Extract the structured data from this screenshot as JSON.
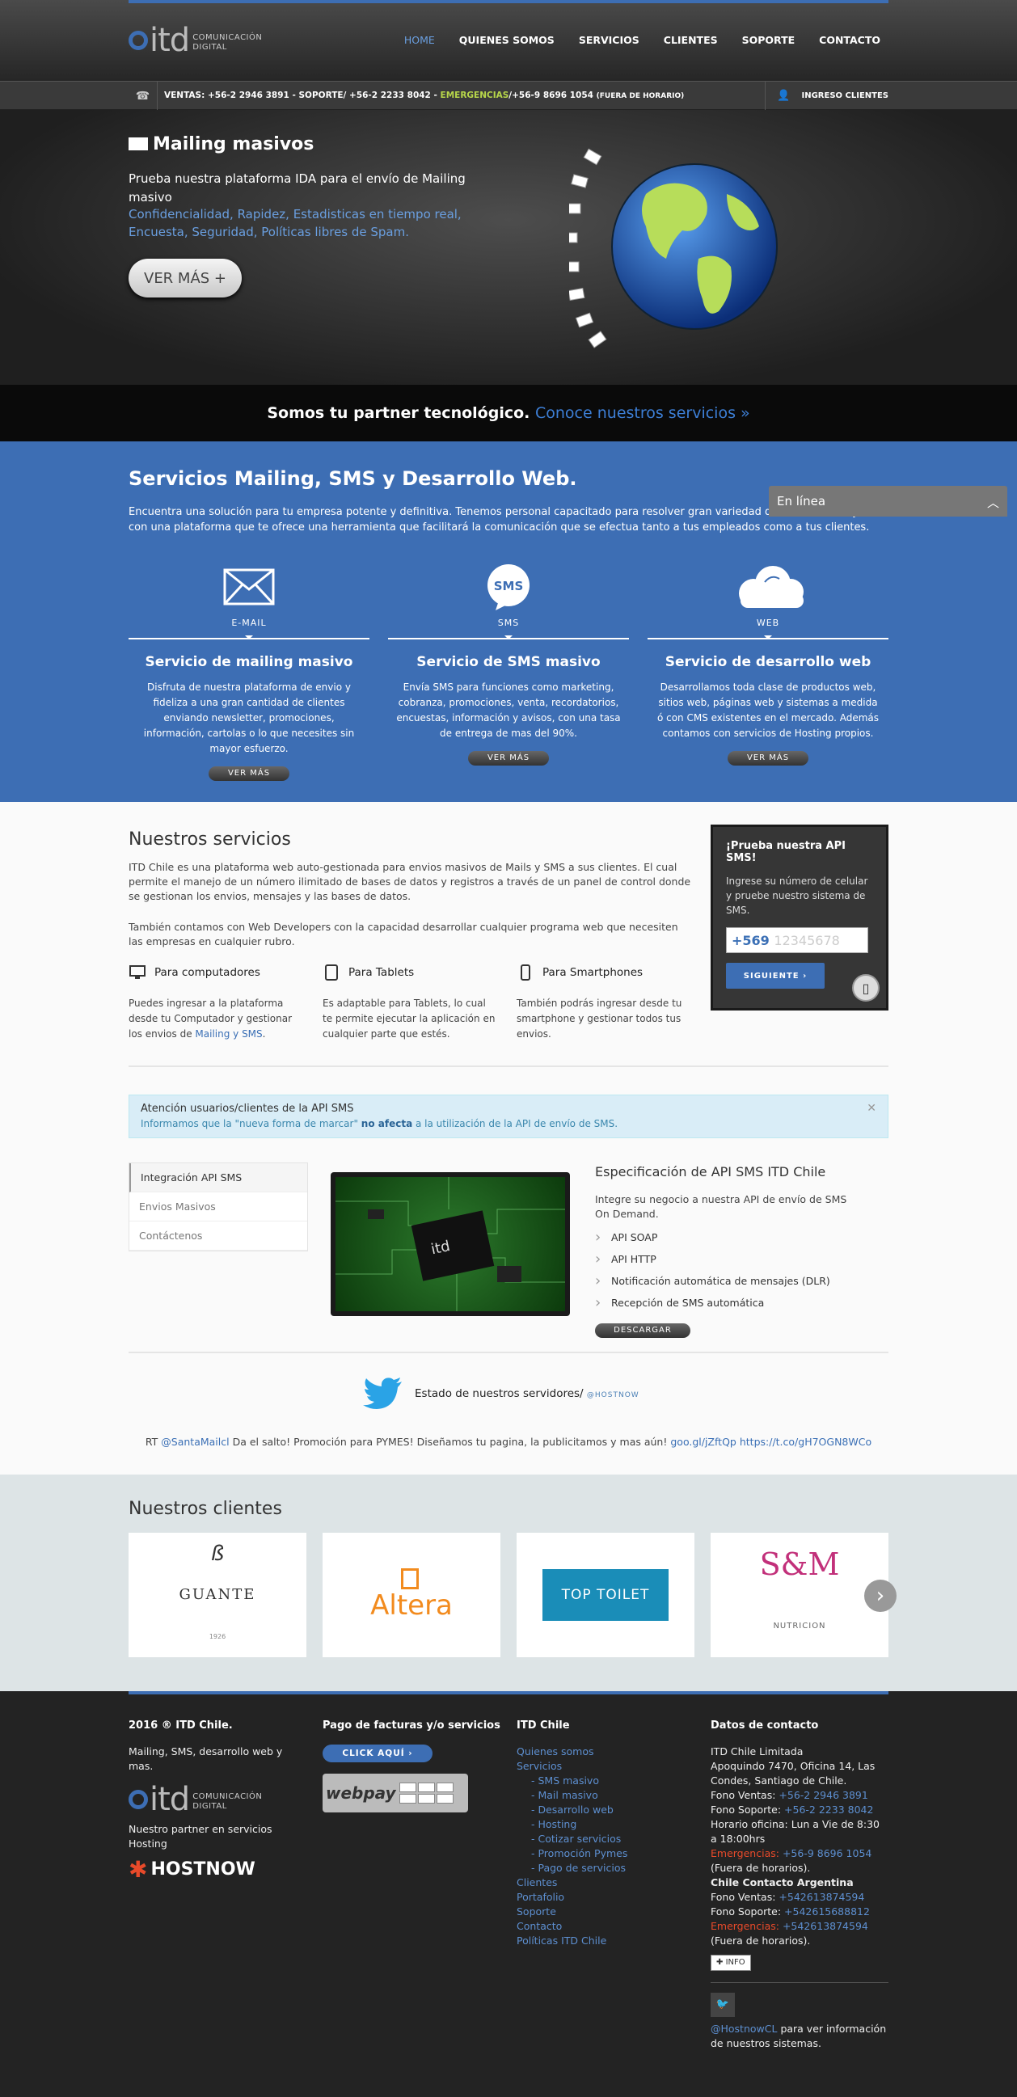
{
  "header": {
    "logo_text": "itd",
    "logo_sub1": "COMUNICACIÓN",
    "logo_sub2": "DIGITAL",
    "nav": [
      "HOME",
      "QUIENES SOMOS",
      "SERVICIOS",
      "CLIENTES",
      "SOPORTE",
      "CONTACTO"
    ]
  },
  "infobar": {
    "sales": "VENTAS: +56-2 2946 3891 - SOPORTE/ +56-2 2233 8042 -",
    "emergency_label": "EMERGENCIAS",
    "emergency_num": "/+56-9 8696 1054",
    "emergency_note": "(FUERA DE HORARIO)",
    "login": "INGRESO CLIENTES"
  },
  "hero": {
    "title": "Mailing masivos",
    "lead": "Prueba nuestra plataforma IDA para el envío de Mailing masivo",
    "lead2": "Confidencialidad, Rapidez, Estadisticas en tiempo real, Encuesta, Seguridad, Políticas libres de Spam.",
    "button": "VER MÁS +"
  },
  "partner": {
    "text": "Somos tu partner tecnológico.",
    "link": "Conoce nuestros servicios »"
  },
  "services": {
    "title": "Servicios Mailing, SMS y Desarrollo Web.",
    "intro": "Encuentra una solución para tu empresa potente y definitiva. Tenemos personal capacitado para resolver gran variedad de desarrollo Y'ayuda con una plataforma que te ofrece una herramienta que facilitará la comunicación que se efectua tanto a tus empleados como a tus clientes.",
    "chat": "En línea",
    "items": [
      {
        "label": "E-MAIL",
        "title": "Servicio de mailing masivo",
        "text": "Disfruta de nuestra plataforma de envio y fideliza a una gran cantidad de clientes enviando newsletter, promociones, información, cartolas o lo que necesites sin mayor esfuerzo.",
        "button": "VER MÁS"
      },
      {
        "label": "SMS",
        "title": "Servicio de SMS masivo",
        "text": "Envía SMS para funciones como marketing, cobranza, promociones, venta, recordatorios, encuestas, información y avisos, con una tasa de entrega de mas del 90%.",
        "button": "VER MÁS"
      },
      {
        "label": "WEB",
        "title": "Servicio de desarrollo web",
        "text": "Desarrollamos toda clase de productos web, sitios web, páginas web y sistemas a medida ó con CMS existentes en el mercado. Además contamos con servicios de Hosting propios.",
        "button": "VER MÁS"
      }
    ]
  },
  "ours": {
    "title": "Nuestros servicios",
    "p1": "ITD Chile es una plataforma web auto-gestionada para envios masivos de Mails y SMS a sus clientes. El cual permite el manejo de un número ilimitado de bases de datos y registros a través de un panel de control donde se gestionan los envios, mensajes y las bases de datos.",
    "p2": "También contamos con Web Developers con la capacidad desarrollar cualquier programa web que necesiten las empresas en cualquier rubro.",
    "devices": [
      {
        "title": "Para computadores",
        "text": "Puedes ingresar a la plataforma desde tu Computador y gestionar los envios de",
        "link": "Mailing y SMS",
        "end": "."
      },
      {
        "title": "Para Tablets",
        "text": "Es adaptable para Tablets, lo cual te permite ejecutar la aplicación en cualquier parte que estés.",
        "link": "",
        "end": ""
      },
      {
        "title": "Para Smartphones",
        "text": "También podrás ingresar desde tu smartphone y gestionar todos tus envios.",
        "link": "",
        "end": ""
      }
    ],
    "api": {
      "title": "¡Prueba nuestra API SMS!",
      "text": "Ingrese su número de celular y pruebe nuestro sistema de SMS.",
      "prefix": "+569",
      "placeholder": "12345678",
      "button": "SIGUIENTE ›"
    },
    "alert": {
      "title": "Atención usuarios/clientes de la API SMS",
      "pre": "Informamos que la \"nueva forma de marcar\"",
      "bold": "no afecta",
      "post": "a la utilización de la API de envío de SMS."
    },
    "tabs": [
      "Integración API SMS",
      "Envios Masivos",
      "Contáctenos"
    ],
    "spec": {
      "title": "Especificación de API SMS ITD Chile",
      "text": "Integre su negocio a nuestra API de envío de SMS On Demand.",
      "items": [
        "API SOAP",
        "API HTTP",
        "Notificación automática de mensajes (DLR)",
        "Recepción de SMS automática"
      ],
      "button": "DESCARGAR"
    },
    "status": {
      "text": "Estado de nuestros servidores/",
      "handle": "@HOSTNOW"
    },
    "tweet": {
      "pre": "RT",
      "handle": "@SantaMailcl",
      "text": "Da el salto! Promoción para PYMES! Diseñamos tu pagina, la publicitamos y mas aún!",
      "link1": "goo.gl/jZftQp",
      "link2": "https://t.co/gH7OGN8WCo"
    }
  },
  "clients": {
    "title": "Nuestros clientes",
    "logos": [
      {
        "name": "GUANTE",
        "sub": "1926",
        "color": "#333"
      },
      {
        "name": "Altera",
        "sub": "",
        "color": "#f28b1e"
      },
      {
        "name": "TOP TOILET",
        "sub": "",
        "color": "#ffffff"
      },
      {
        "name": "S&M",
        "sub": "NUTRICION",
        "color": "#c2307a"
      }
    ]
  },
  "footer": {
    "c1": {
      "title": "2016 ® ITD Chile.",
      "text": "Mailing, SMS, desarrollo web y mas.",
      "partner": "Nuestro partner en servicios Hosting",
      "hostnow": "HOSTNOW"
    },
    "c2": {
      "title": "Pago de facturas y/o servicios",
      "button": "CLICK AQUÍ ›",
      "webpay": "webpay"
    },
    "c3": {
      "title": "ITD Chile",
      "links": [
        "Quienes somos",
        "Servicios"
      ],
      "sub": [
        "- SMS masivo",
        "- Mail masivo",
        "- Desarrollo web",
        "- Hosting",
        "- Cotizar servicios",
        "- Promoción Pymes",
        "- Pago de servicios"
      ],
      "links2": [
        "Clientes",
        "Portafolio",
        "Soporte",
        "Contacto",
        "Políticas ITD Chile"
      ]
    },
    "c4": {
      "title": "Datos de contacto",
      "company": "ITD Chile Limitada",
      "address": "Apoquindo 7470, Oficina 14, Las Condes, Santiago de Chile.",
      "ventas_l": "Fono Ventas:",
      "ventas": "+56-2 2946 3891",
      "soporte_l": "Fono Soporte:",
      "soporte": "+56-2 2233 8042",
      "horario": "Horario oficina: Lun a Vie de 8:30 a 18:00hrs",
      "emerg_l": "Emergencias:",
      "emerg": "+56-9 8696 1054",
      "emerg_note": "(Fuera de horarios).",
      "arg": "Chile Contacto Argentina",
      "aventas": "+542613874594",
      "asoporte": "+542615688812",
      "aemerg": "+542613874594",
      "aemerg_note": "(Fuera de horarios).",
      "info": "INFO",
      "twitter": "@HostnowCL",
      "twitter_text": "para ver información de nuestros sistemas."
    }
  }
}
